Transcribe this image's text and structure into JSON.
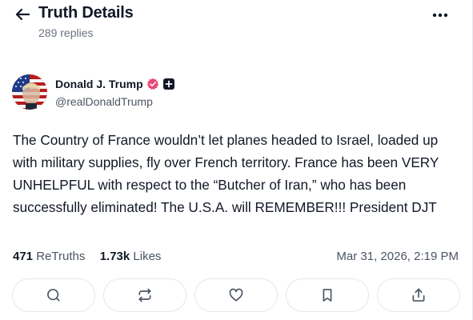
{
  "header": {
    "title": "Truth Details",
    "subtitle": "289 replies"
  },
  "post": {
    "author_name": "Donald J. Trump",
    "handle": "@realDonaldTrump",
    "text": "The Country of France wouldn’t let planes headed to Israel, loaded up with military supplies, fly over French territory. France has been VERY UNHELPFUL with respect to the “Butcher of Iran,” who has been successfully eliminated! The U.S.A. will REMEMBER!!! President DJT",
    "retruths_count": "471",
    "retruths_label": "ReTruths",
    "likes_count": "1.73k",
    "likes_label": "Likes",
    "timestamp": "Mar 31, 2026, 2:19 PM"
  },
  "icons": {
    "back": "arrow-left-icon",
    "more": "more-horizontal-icon",
    "verified": "verified-badge-icon",
    "plus": "plus-badge-icon",
    "reply": "reply-icon",
    "retruth": "retruth-icon",
    "like": "heart-icon",
    "bookmark": "bookmark-icon",
    "share": "share-icon"
  },
  "colors": {
    "verified": "#e8487a",
    "text": "#111827",
    "muted": "#6b7280"
  }
}
